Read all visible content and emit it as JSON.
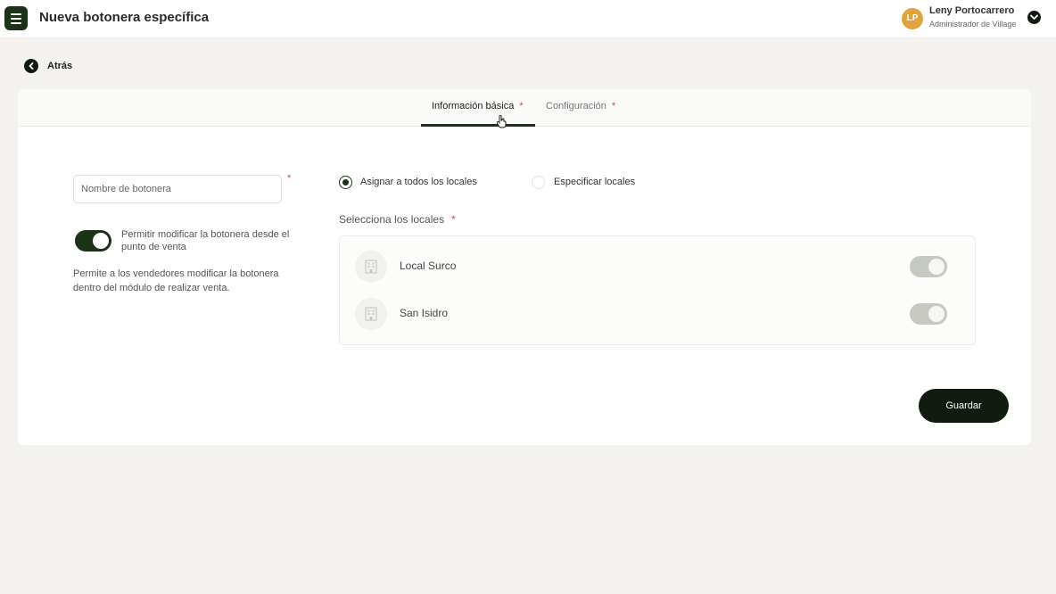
{
  "header": {
    "title": "Nueva botonera específica",
    "user": {
      "initials": "LP",
      "name": "Leny Portocarrero",
      "role": "Administrador de Village"
    }
  },
  "nav": {
    "back_label": "Atrás"
  },
  "tabs": [
    {
      "label": "Información básica",
      "required_mark": "*",
      "active": true
    },
    {
      "label": "Configuración",
      "required_mark": "*",
      "active": false
    }
  ],
  "form": {
    "name_field": {
      "placeholder": "Nombre de botonera",
      "value": "",
      "required_mark": "*"
    },
    "allow_edit_toggle": {
      "on": true,
      "label": "Permitir modificar la botonera desde el punto de venta",
      "help": "Permite a los vendedores modificar la botonera dentro del módulo de realizar venta."
    },
    "assign_options": [
      {
        "label": "Asignar a todos los locales",
        "selected": true
      },
      {
        "label": "Especificar locales",
        "selected": false
      }
    ],
    "stores_section": {
      "title": "Selecciona los locales",
      "required_mark": "*",
      "stores": [
        {
          "name": "Local Surco",
          "enabled": true,
          "icon": "building-icon"
        },
        {
          "name": "San Isidro",
          "enabled": true,
          "icon": "building-icon"
        }
      ]
    },
    "save_label": "Guardar"
  },
  "colors": {
    "primary": "#1d3318",
    "required": "#e04a4a",
    "avatar": "#e2a43a",
    "background": "#f3f2ef"
  }
}
